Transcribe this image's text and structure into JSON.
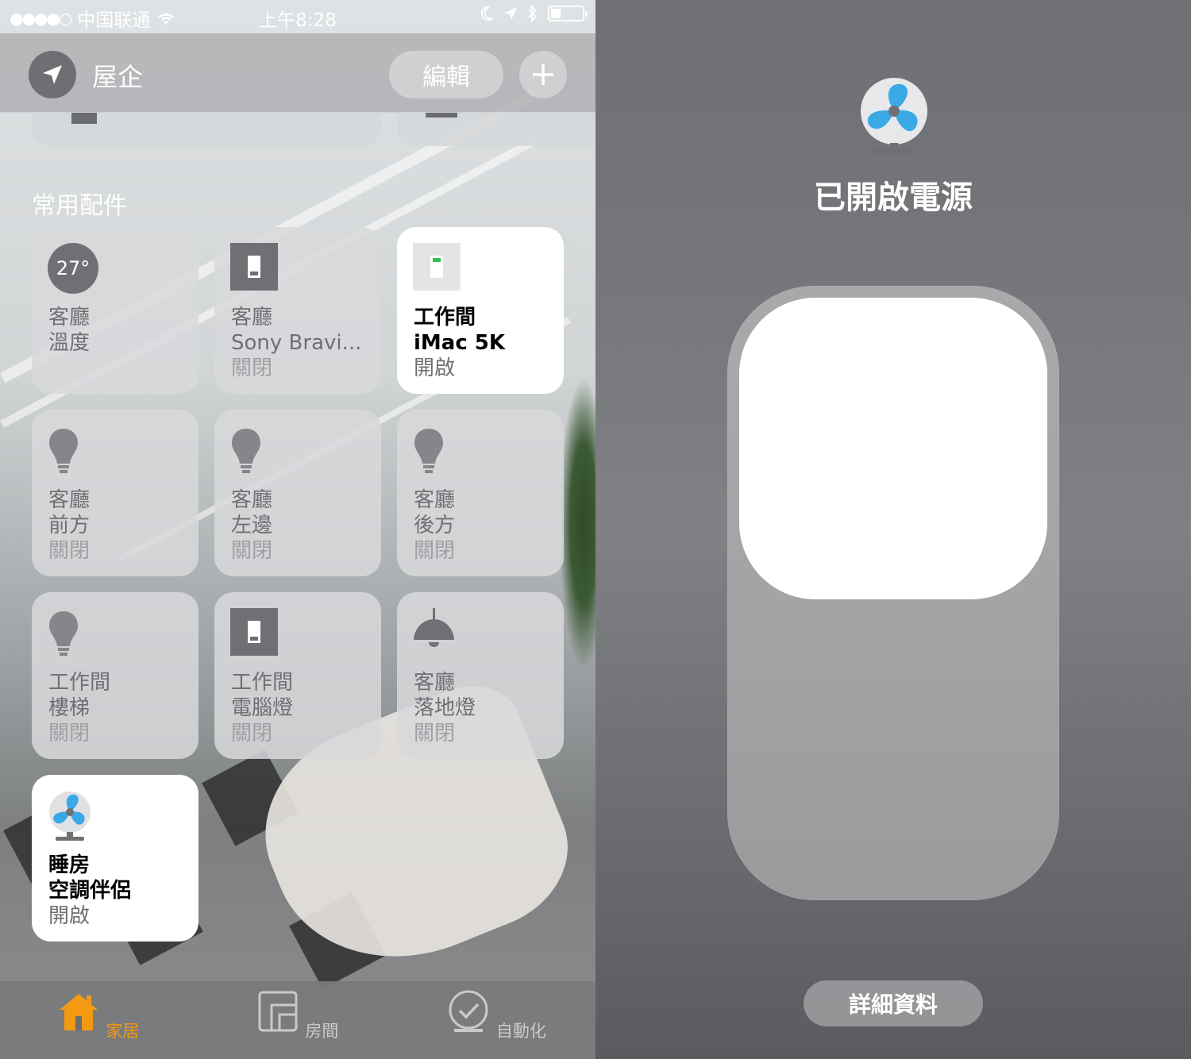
{
  "status_bar": {
    "signal_dots": "●●●●○",
    "carrier": "中国联通",
    "time": "上午8:28"
  },
  "header": {
    "home_name": "屋企",
    "edit_label": "編輯"
  },
  "section": {
    "title": "常用配件"
  },
  "tiles": [
    {
      "icon": "thermometer-icon",
      "temp": "27°",
      "room": "客廳",
      "name": "溫度",
      "state": ""
    },
    {
      "icon": "switch-icon",
      "room": "客廳",
      "name": "Sony Bravi...",
      "state": "關閉"
    },
    {
      "icon": "switch-on-icon",
      "room": "工作間",
      "name": "iMac 5K",
      "state": "開啟"
    },
    {
      "icon": "bulb-icon",
      "room": "客廳",
      "name": "前方",
      "state": "關閉"
    },
    {
      "icon": "bulb-icon",
      "room": "客廳",
      "name": "左邊",
      "state": "關閉"
    },
    {
      "icon": "bulb-icon",
      "room": "客廳",
      "name": "後方",
      "state": "關閉"
    },
    {
      "icon": "bulb-icon",
      "room": "工作間",
      "name": "樓梯",
      "state": "關閉"
    },
    {
      "icon": "switch-icon",
      "room": "工作間",
      "name": "電腦燈",
      "state": "關閉"
    },
    {
      "icon": "pendant-lamp-icon",
      "room": "客廳",
      "name": "落地燈",
      "state": "關閉"
    },
    {
      "icon": "fan-icon",
      "room": "睡房",
      "name": "空調伴侶",
      "state": "開啟"
    }
  ],
  "tabbar": {
    "home": "家居",
    "rooms": "房間",
    "automation": "自動化",
    "active_color": "#f39a12"
  },
  "detail": {
    "icon": "fan-icon",
    "status": "已開啟電源",
    "power_level": 1.0,
    "details_button": "詳細資料",
    "fan_color": "#3aa9e6"
  }
}
